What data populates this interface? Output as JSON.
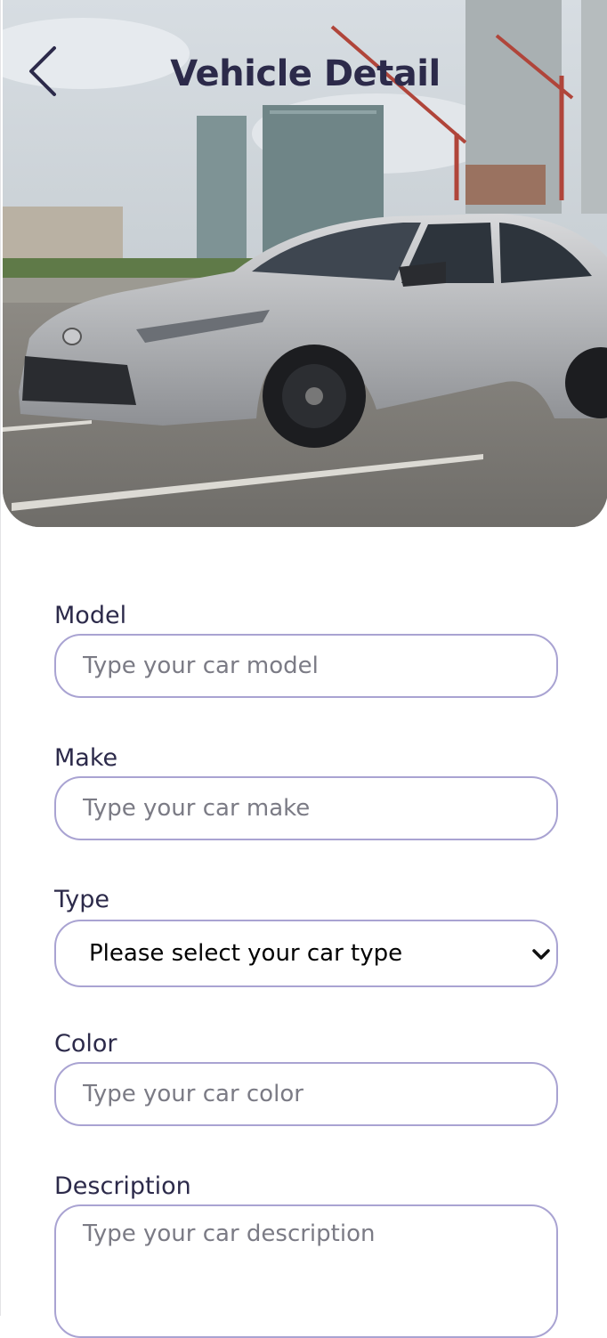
{
  "header": {
    "title": "Vehicle Detail",
    "back_icon": "chevron-left-icon"
  },
  "hero": {
    "image": "car-photo"
  },
  "form": {
    "model": {
      "label": "Model",
      "placeholder": "Type your car model",
      "value": ""
    },
    "make": {
      "label": "Make",
      "placeholder": "Type your car make",
      "value": ""
    },
    "type": {
      "label": "Type",
      "selected": "Please select your car type",
      "icon": "chevron-down-icon"
    },
    "color": {
      "label": "Color",
      "placeholder": "Type your car color",
      "value": ""
    },
    "description": {
      "label": "Description",
      "placeholder": "Type your car description",
      "value": ""
    }
  },
  "colors": {
    "title": "#2c2a4a",
    "input_border": "#a9a3d2",
    "placeholder": "#7b7b85"
  }
}
